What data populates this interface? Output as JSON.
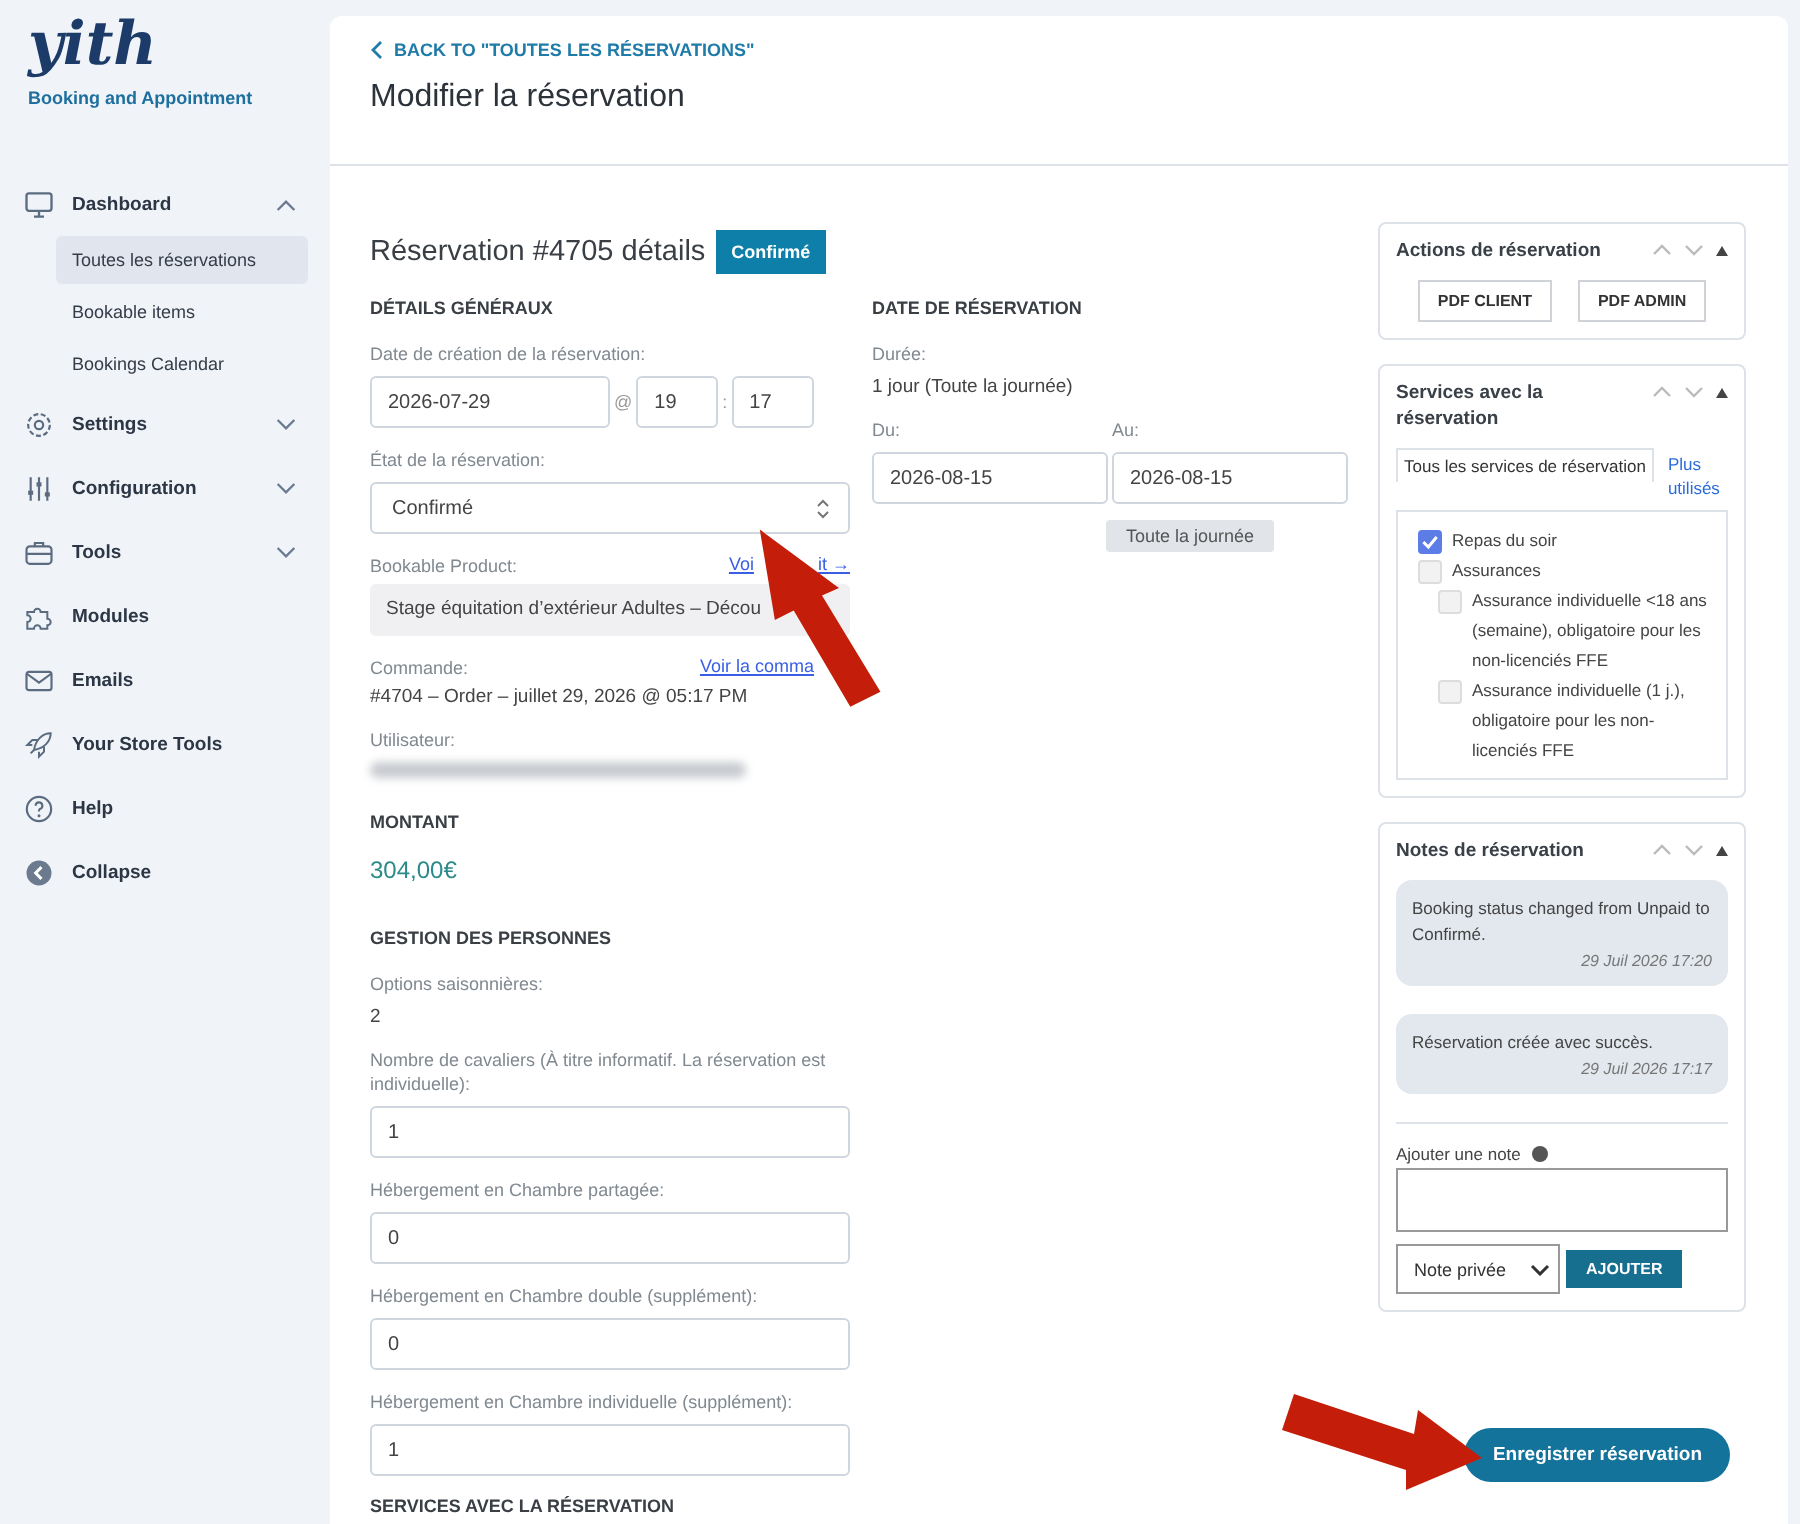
{
  "brand": {
    "logo": "yith",
    "subtitle": "Booking and Appointment"
  },
  "sidebar": {
    "items": [
      {
        "label": "Dashboard",
        "kind": "group",
        "expanded": true,
        "children": [
          {
            "label": "Toutes les réservations",
            "selected": true
          },
          {
            "label": "Bookable items",
            "selected": false
          },
          {
            "label": "Bookings Calendar",
            "selected": false
          }
        ]
      },
      {
        "label": "Settings",
        "kind": "group",
        "expanded": false
      },
      {
        "label": "Configuration",
        "kind": "group",
        "expanded": false
      },
      {
        "label": "Tools",
        "kind": "group",
        "expanded": false
      },
      {
        "label": "Modules",
        "kind": "link"
      },
      {
        "label": "Emails",
        "kind": "link"
      },
      {
        "label": "Your Store Tools",
        "kind": "link"
      },
      {
        "label": "Help",
        "kind": "link"
      },
      {
        "label": "Collapse",
        "kind": "link"
      }
    ]
  },
  "back_link": "BACK TO \"TOUTES LES RÉSERVATIONS\"",
  "page_title": "Modifier la réservation",
  "reservation": {
    "title": "Réservation #4705 détails",
    "status": "Confirmé"
  },
  "general": {
    "heading": "DÉTAILS GÉNÉRAUX",
    "created_label": "Date de création de la réservation:",
    "created_date": "2026-07-29",
    "at": "@",
    "hour": "19",
    "colon": ":",
    "minute": "17",
    "state_label": "État de la réservation:",
    "state_value": "Confirmé",
    "product_label": "Bookable Product:",
    "product_link_start": "Voi",
    "product_link_end": "it →",
    "product_value": "Stage équitation d’extérieur Adultes – Décou",
    "order_label": "Commande:",
    "order_link": "Voir la comma",
    "order_value": "#4704 – Order – juillet 29, 2026 @ 05:17 PM",
    "user_label": "Utilisateur:"
  },
  "amount": {
    "heading": "MONTANT",
    "value": "304,00€"
  },
  "dates": {
    "heading": "DATE DE RÉSERVATION",
    "duration_label": "Durée:",
    "duration_value": "1 jour (Toute la journée)",
    "from_label": "Du:",
    "from_value": "2026-08-15",
    "to_label": "Au:",
    "to_value": "2026-08-15",
    "tooltip": "Toute la journée"
  },
  "persons": {
    "heading": "GESTION DES PERSONNES",
    "options_label": "Options saisonnières:",
    "options_value": "2",
    "fields": [
      {
        "label": "Nombre de cavaliers (À titre informatif. La réservation est individuelle):",
        "value": "1"
      },
      {
        "label": "Hébergement en Chambre partagée:",
        "value": "0"
      },
      {
        "label": "Hébergement en Chambre double (supplément):",
        "value": "0"
      },
      {
        "label": "Hébergement en Chambre individuelle (supplément):",
        "value": "1"
      }
    ]
  },
  "services_heading": "SERVICES AVEC LA RÉSERVATION",
  "actions_panel": {
    "title": "Actions de réservation",
    "buttons": [
      "PDF CLIENT",
      "PDF ADMIN"
    ]
  },
  "services_panel": {
    "title": "Services avec la réservation",
    "tabs": [
      {
        "label": "Tous les services de réservation",
        "selected": true
      },
      {
        "label": "Plus utilisés",
        "selected": false
      }
    ],
    "items": [
      {
        "label": "Repas du soir",
        "checked": true
      },
      {
        "label": "Assurances",
        "checked": false,
        "children": [
          {
            "label": "Assurance individuelle <18 ans (semaine), obligatoire pour les non-licenciés FFE",
            "checked": false
          },
          {
            "label": "Assurance individuelle (1 j.), obligatoire pour les non-licenciés FFE",
            "checked": false
          }
        ]
      }
    ]
  },
  "notes_panel": {
    "title": "Notes de réservation",
    "notes": [
      {
        "text": "Booking status changed from Unpaid to Confirmé.",
        "date": "29 Juil 2026 17:20"
      },
      {
        "text": "Réservation créée avec succès.",
        "date": "29 Juil 2026 17:17"
      }
    ],
    "add_label": "Ajouter une note",
    "note_type": "Note privée",
    "add_button": "AJOUTER"
  },
  "save_button": "Enregistrer réservation"
}
